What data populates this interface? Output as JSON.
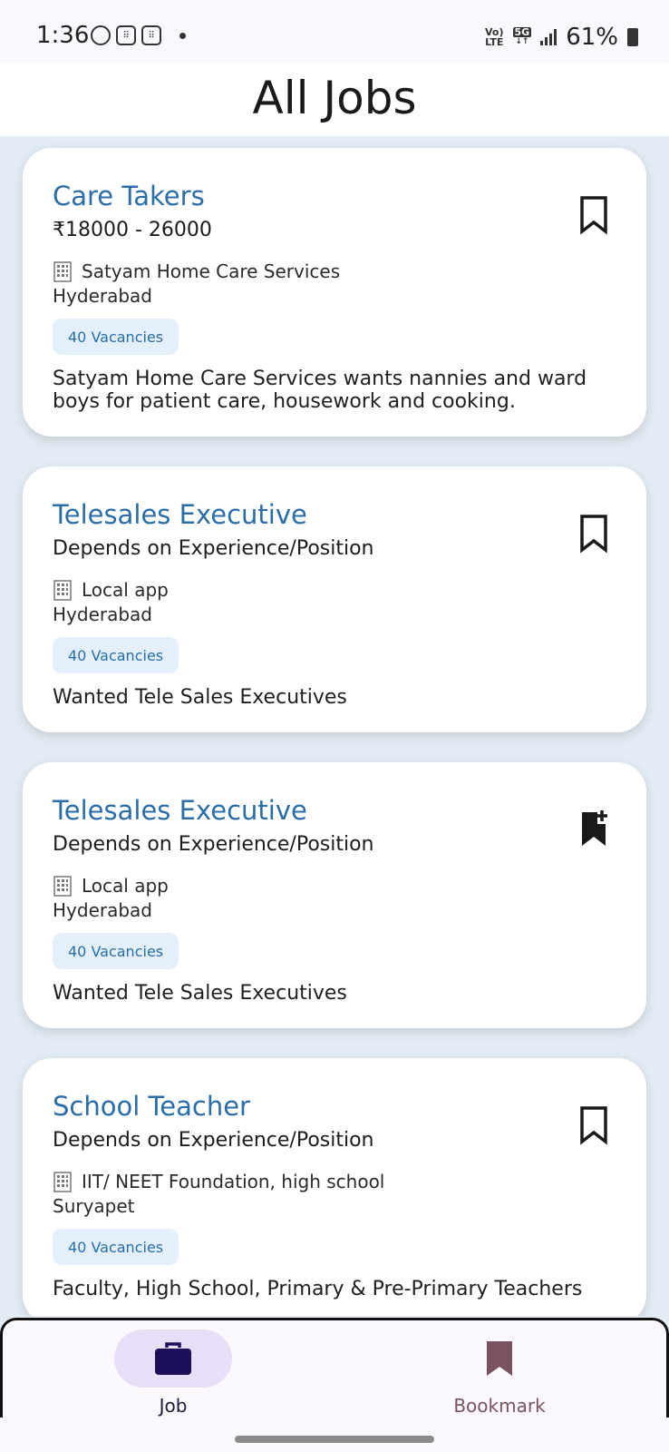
{
  "status_bar": {
    "time": "1:36",
    "network_top": "Vo)",
    "network_bottom": "LTE",
    "network_5g": "5G",
    "battery": "61%"
  },
  "header": {
    "title": "All Jobs"
  },
  "jobs": [
    {
      "title": "Care Takers",
      "salary": "₹18000 - 26000",
      "company": "Satyam Home Care Services",
      "location": "Hyderabad",
      "vacancies": "40 Vacancies",
      "description": "Satyam Home Care Services wants nannies and ward boys for patient care, housework and cooking.",
      "bookmark_icon": "bookmark-outline-icon"
    },
    {
      "title": "Telesales Executive",
      "salary": "Depends on Experience/Position",
      "company": "Local app",
      "location": "Hyderabad",
      "vacancies": "40 Vacancies",
      "description": "Wanted Tele Sales Executives",
      "bookmark_icon": "bookmark-outline-icon"
    },
    {
      "title": "Telesales Executive",
      "salary": "Depends on Experience/Position",
      "company": "Local app",
      "location": "Hyderabad",
      "vacancies": "40 Vacancies",
      "description": "Wanted Tele Sales Executives",
      "bookmark_icon": "bookmark-added-icon"
    },
    {
      "title": "School Teacher",
      "salary": "Depends on Experience/Position",
      "company": "IIT/ NEET Foundation, high school",
      "location": "Suryapet",
      "vacancies": "40 Vacancies",
      "description": "Faculty, High School, Primary & Pre-Primary Teachers",
      "bookmark_icon": "bookmark-outline-icon"
    }
  ],
  "bottom_nav": {
    "job_label": "Job",
    "bookmark_label": "Bookmark",
    "active": "Job"
  },
  "colors": {
    "title_blue": "#2a6da8",
    "badge_bg": "#e3f0fb",
    "nav_pill": "#e8def8",
    "job_icon": "#1d0f5a",
    "bookmark_nav_icon": "#7a5360"
  }
}
